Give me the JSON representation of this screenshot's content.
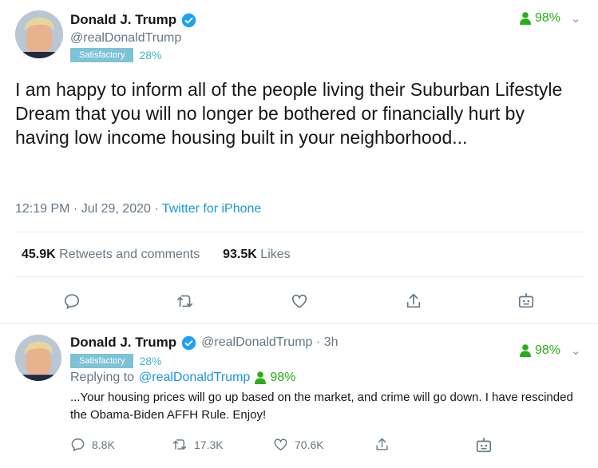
{
  "main_tweet": {
    "author_name": "Donald J. Trump",
    "handle": "@realDonaldTrump",
    "badge_label": "Satisfactory",
    "badge_percent": "28%",
    "score": "98%",
    "text": "I am happy to inform all of the people living their Suburban Lifestyle Dream that you will no longer be bothered or financially hurt by having low income housing built in your neighborhood...",
    "time": "12:19 PM · Jul 29, 2020 · ",
    "source": "Twitter for iPhone",
    "retweets_count": "45.9K",
    "retweets_label": "Retweets and comments",
    "likes_count": "93.5K",
    "likes_label": "Likes"
  },
  "reply_tweet": {
    "author_name": "Donald J. Trump",
    "handle_time": "@realDonaldTrump · 3h",
    "badge_label": "Satisfactory",
    "badge_percent": "28%",
    "score": "98%",
    "replying_prefix": "Replying to",
    "replying_to": "@realDonaldTrump",
    "replying_score": "98%",
    "text": "...Your housing prices will go up based on the market, and crime will go down. I have rescinded the Obama-Biden AFFH Rule. Enjoy!",
    "reply_count": "8.8K",
    "retweet_count": "17.3K",
    "like_count": "70.6K"
  },
  "colors": {
    "score_green": "#27ae19",
    "link_blue": "#1b95e0",
    "badge_blue": "#7cc3d8",
    "muted": "#657786"
  },
  "icons": [
    "verified-icon",
    "person-icon",
    "chevron-down-icon",
    "reply-icon",
    "retweet-icon",
    "like-icon",
    "share-icon",
    "bot-icon"
  ]
}
